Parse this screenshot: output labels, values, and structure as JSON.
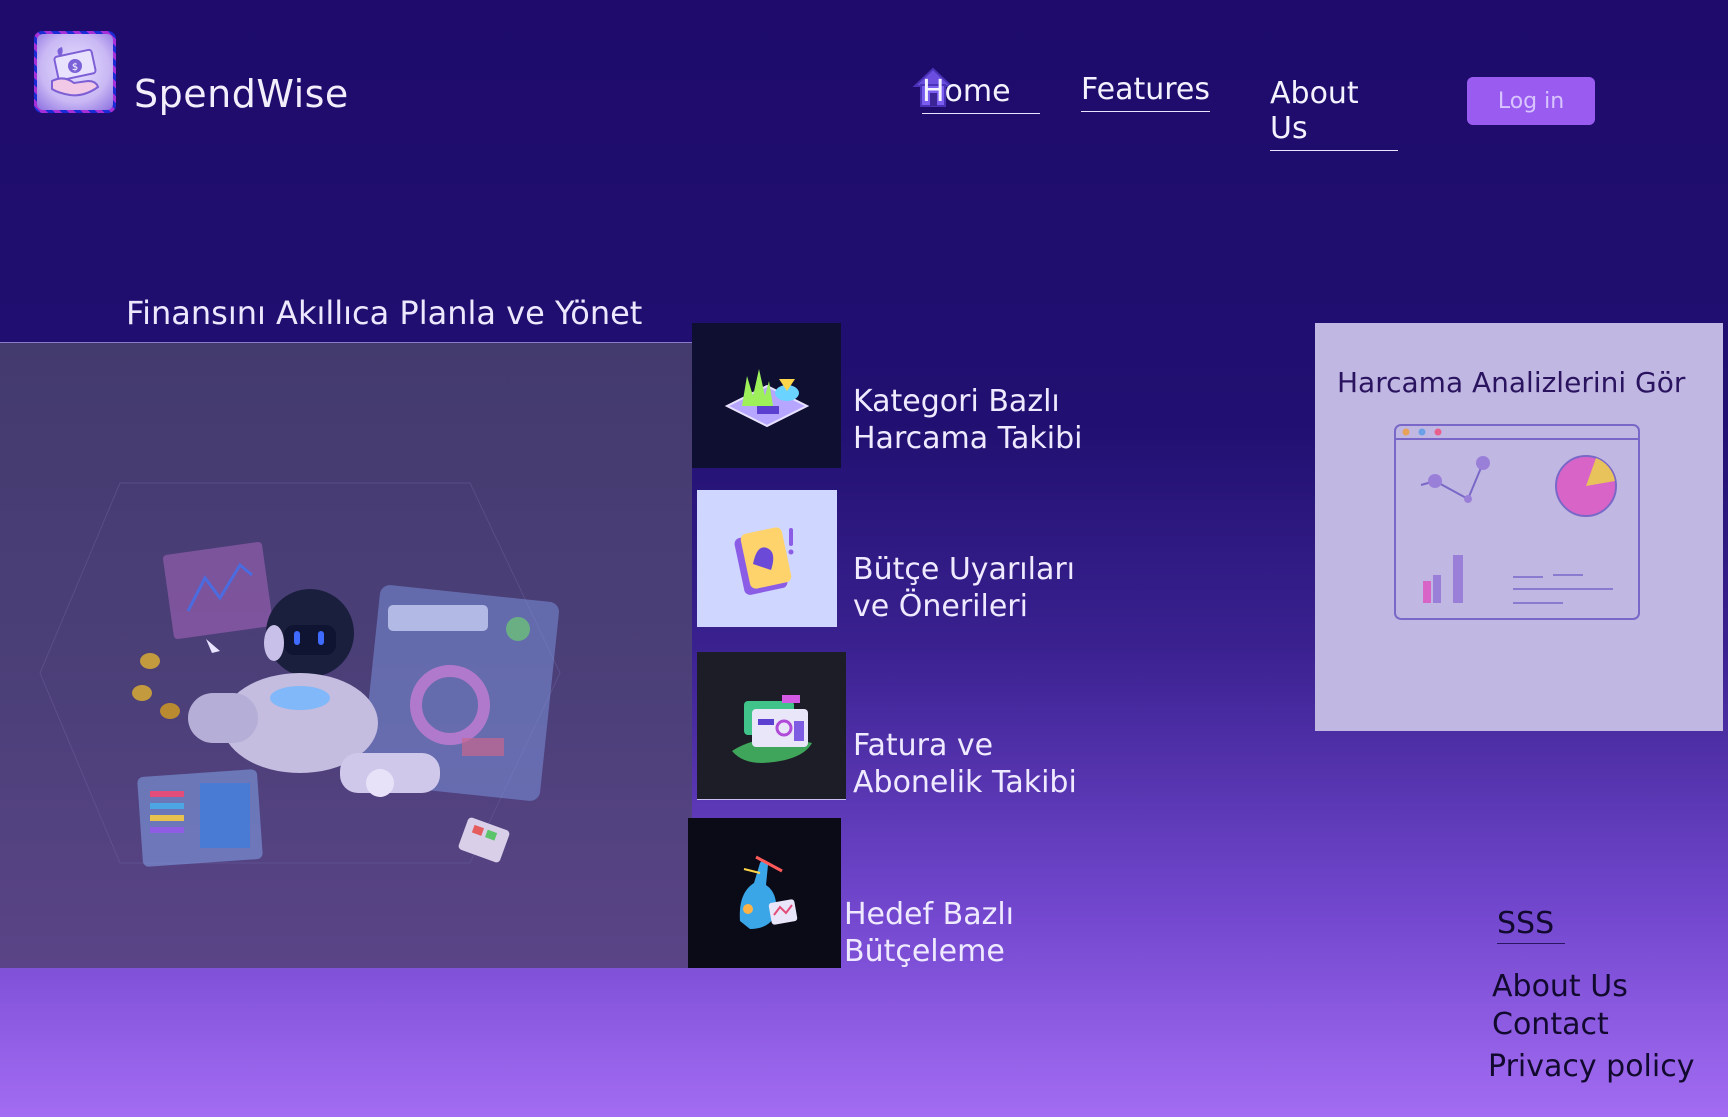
{
  "header": {
    "brand": "SpendWise",
    "nav": {
      "home": "Home",
      "features": "Features",
      "about": "About Us"
    },
    "login_label": "Log in"
  },
  "hero": {
    "title": "Finansını Akıllıca Planla ve Yönet"
  },
  "features": [
    {
      "line1": "Kategori Bazlı",
      "line2": "Harcama Takibi"
    },
    {
      "line1": "Bütçe Uyarıları",
      "line2": "ve Önerileri"
    },
    {
      "line1": "Fatura ve",
      "line2": "Abonelik Takibi"
    },
    {
      "line1": "Hedef Bazlı",
      "line2": "Bütçeleme"
    }
  ],
  "analysis_card": {
    "title": "Harcama Analizlerini Gör"
  },
  "footer": {
    "sss": "SSS",
    "about": "About Us",
    "contact": "Contact",
    "privacy": "Privacy policy"
  },
  "colors": {
    "background_top": "#1e0b6b",
    "background_bottom": "#a36cf2",
    "login_button": "#9a5cf0",
    "card": "#c0b7e2"
  },
  "icons": {
    "logo": "hand-money-icon",
    "home": "home-icon"
  }
}
